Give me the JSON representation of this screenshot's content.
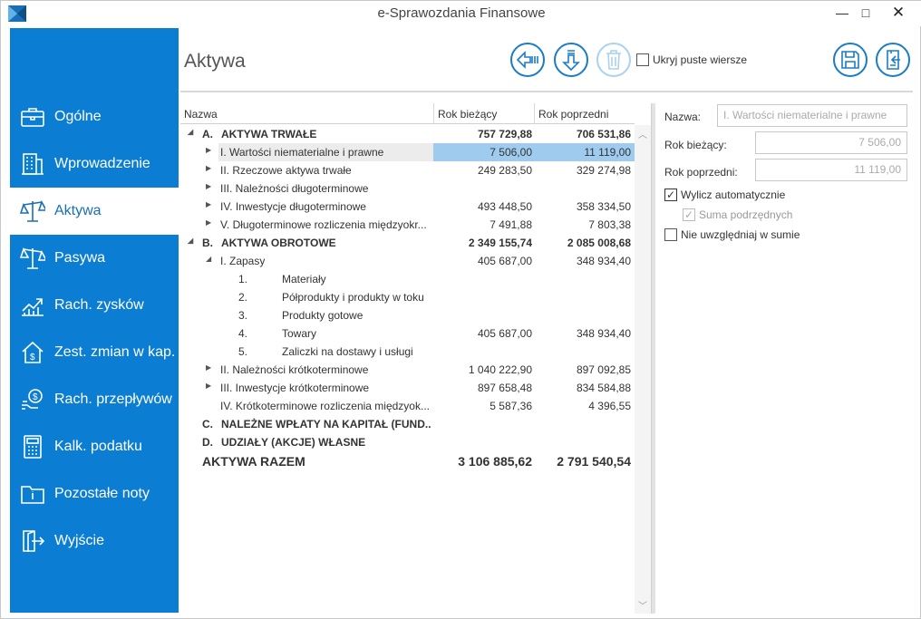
{
  "app": {
    "title": "e-Sprawozdania Finansowe"
  },
  "window_controls": {
    "minimize": "—",
    "maximize": "□",
    "close": "✕"
  },
  "sidebar": {
    "items": [
      {
        "label": "Ogólne",
        "icon": "briefcase-icon",
        "active": false
      },
      {
        "label": "Wprowadzenie",
        "icon": "building-icon",
        "active": false
      },
      {
        "label": "Aktywa",
        "icon": "scales-icon",
        "active": true
      },
      {
        "label": "Pasywa",
        "icon": "scales-icon",
        "active": false
      },
      {
        "label": "Rach. zysków",
        "icon": "chart-up-icon",
        "active": false
      },
      {
        "label": "Zest. zmian w kap.",
        "icon": "house-dollar-icon",
        "active": false
      },
      {
        "label": "Rach. przepływów",
        "icon": "money-flow-icon",
        "active": false
      },
      {
        "label": "Kalk. podatku",
        "icon": "calculator-icon",
        "active": false
      },
      {
        "label": "Pozostałe noty",
        "icon": "folder-info-icon",
        "active": false
      },
      {
        "label": "Wyjście",
        "icon": "exit-door-icon",
        "active": false
      }
    ]
  },
  "header": {
    "title": "Aktywa",
    "hide_empty_label": "Ukryj puste wiersze",
    "hide_empty_checked": false
  },
  "grid": {
    "columns": [
      "Nazwa",
      "Rok bieżący",
      "Rok poprzedni"
    ],
    "rows": [
      {
        "toggle": "◢",
        "num": "A.",
        "name": "AKTYWA TRWAŁE",
        "cur": "757 729,88",
        "prev": "706 531,86",
        "bold": true,
        "level": 0
      },
      {
        "toggle": "▶",
        "num": "",
        "name": "I. Wartości niematerialne i prawne",
        "cur": "7 506,00",
        "prev": "11 119,00",
        "bold": false,
        "level": 1,
        "selected": true
      },
      {
        "toggle": "▶",
        "num": "",
        "name": "II. Rzeczowe aktywa trwałe",
        "cur": "249 283,50",
        "prev": "329 274,98",
        "bold": false,
        "level": 1
      },
      {
        "toggle": "▶",
        "num": "",
        "name": "III. Należności długoterminowe",
        "cur": "",
        "prev": "",
        "bold": false,
        "level": 1
      },
      {
        "toggle": "▶",
        "num": "",
        "name": "IV. Inwestycje długoterminowe",
        "cur": "493 448,50",
        "prev": "358 334,50",
        "bold": false,
        "level": 1
      },
      {
        "toggle": "▶",
        "num": "",
        "name": "V. Długoterminowe rozliczenia międzyokr...",
        "cur": "7 491,88",
        "prev": "7 803,38",
        "bold": false,
        "level": 1
      },
      {
        "toggle": "◢",
        "num": "B.",
        "name": "AKTYWA OBROTOWE",
        "cur": "2 349 155,74",
        "prev": "2 085 008,68",
        "bold": true,
        "level": 0
      },
      {
        "toggle": "◢",
        "num": "",
        "name": "I. Zapasy",
        "cur": "405 687,00",
        "prev": "348 934,40",
        "bold": false,
        "level": 1
      },
      {
        "toggle": "",
        "num": "1.",
        "name": "Materiały",
        "cur": "",
        "prev": "",
        "bold": false,
        "level": 2
      },
      {
        "toggle": "",
        "num": "2.",
        "name": "Półprodukty i produkty w toku",
        "cur": "",
        "prev": "",
        "bold": false,
        "level": 2
      },
      {
        "toggle": "",
        "num": "3.",
        "name": "Produkty gotowe",
        "cur": "",
        "prev": "",
        "bold": false,
        "level": 2
      },
      {
        "toggle": "",
        "num": "4.",
        "name": "Towary",
        "cur": "405 687,00",
        "prev": "348 934,40",
        "bold": false,
        "level": 2
      },
      {
        "toggle": "",
        "num": "5.",
        "name": "Zaliczki na dostawy i usługi",
        "cur": "",
        "prev": "",
        "bold": false,
        "level": 2
      },
      {
        "toggle": "▶",
        "num": "",
        "name": "II. Należności krótkoterminowe",
        "cur": "1 040 222,90",
        "prev": "897 092,85",
        "bold": false,
        "level": 1
      },
      {
        "toggle": "▶",
        "num": "",
        "name": "III. Inwestycje krótkoterminowe",
        "cur": "897 658,48",
        "prev": "834 584,88",
        "bold": false,
        "level": 1
      },
      {
        "toggle": "",
        "num": "",
        "name": "IV. Krótkoterminowe rozliczenia międzyok...",
        "cur": "5 587,36",
        "prev": "4 396,55",
        "bold": false,
        "level": 1
      },
      {
        "toggle": "",
        "num": "C.",
        "name": "NALEŻNE WPŁATY NA KAPITAŁ (FUND...",
        "cur": "",
        "prev": "",
        "bold": true,
        "level": 0
      },
      {
        "toggle": "",
        "num": "D.",
        "name": "UDZIAŁY (AKCJE) WŁASNE",
        "cur": "",
        "prev": "",
        "bold": true,
        "level": 0
      }
    ],
    "total": {
      "name": "AKTYWA RAZEM",
      "cur": "3 106 885,62",
      "prev": "2 791 540,54"
    }
  },
  "details": {
    "name_label": "Nazwa:",
    "name_value": "I. Wartości niematerialne i prawne",
    "cur_label": "Rok bieżący:",
    "cur_value": "7 506,00",
    "prev_label": "Rok poprzedni:",
    "prev_value": "11 119,00",
    "auto_label": "Wylicz automatycznie",
    "auto_checked": true,
    "sum_label": "Suma podrzędnych",
    "sum_checked": true,
    "exclude_label": "Nie uwzględniaj w sumie",
    "exclude_checked": false
  },
  "colors": {
    "accent": "#0b7dd2",
    "selection": "#9ecbee",
    "button_ring": "#1b7cc6"
  }
}
